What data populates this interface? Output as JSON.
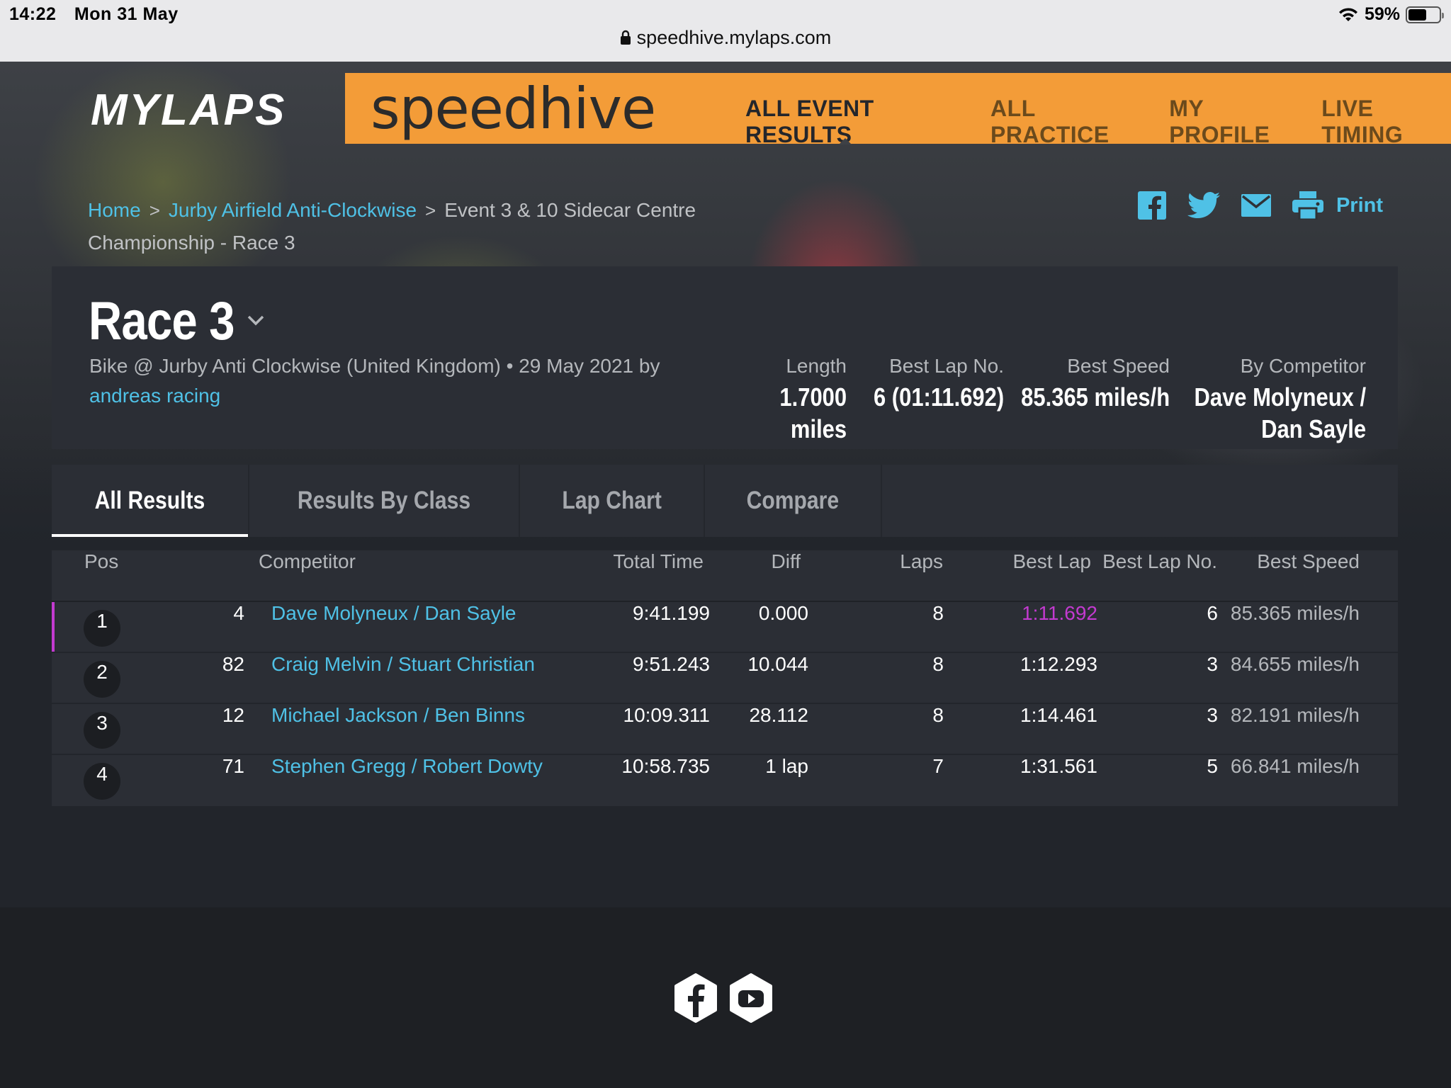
{
  "statusbar": {
    "time": "14:22",
    "date": "Mon 31 May",
    "battery": "59%",
    "battery_level": 0.59
  },
  "browser": {
    "url": "speedhive.mylaps.com"
  },
  "header": {
    "logo": "MYLAPS",
    "brand": "speedhive",
    "nav": [
      {
        "label": "ALL EVENT RESULTS",
        "active": true
      },
      {
        "label": "ALL PRACTICE"
      },
      {
        "label": "MY PROFILE"
      },
      {
        "label": "LIVE TIMING"
      }
    ]
  },
  "breadcrumb": {
    "home": "Home",
    "track": "Jurby Airfield Anti-Clockwise",
    "event": "Event 3 & 10 Sidecar Centre Championship - Race 3"
  },
  "share": {
    "print_label": "Print",
    "icons": [
      "facebook-icon",
      "twitter-icon",
      "mail-icon",
      "printer-icon"
    ]
  },
  "race": {
    "title": "Race 3",
    "subtitle": "Bike @ Jurby Anti Clockwise (United Kingdom) • 29 May 2021 by",
    "organizer": "andreas racing",
    "stats": {
      "length_label": "Length",
      "length_value": "1.7000",
      "length_unit": "miles",
      "best_lap_no_label": "Best Lap No.",
      "best_lap_no_value": "6 (01:11.692)",
      "best_speed_label": "Best Speed",
      "best_speed_value": "85.365 miles/h",
      "by_competitor_label": "By Competitor",
      "by_competitor_line1": "Dave Molyneux /",
      "by_competitor_line2": "Dan Sayle"
    }
  },
  "tabs": [
    {
      "label": "All Results",
      "active": true
    },
    {
      "label": "Results By Class"
    },
    {
      "label": "Lap Chart"
    },
    {
      "label": "Compare"
    }
  ],
  "table": {
    "headers": {
      "pos": "Pos",
      "competitor": "Competitor",
      "total_time": "Total Time",
      "diff": "Diff",
      "laps": "Laps",
      "best_lap": "Best Lap",
      "best_lap_no": "Best Lap No.",
      "best_speed": "Best Speed"
    },
    "rows": [
      {
        "pos": "1",
        "number": "4",
        "competitor": "Dave Molyneux / Dan Sayle",
        "total_time": "9:41.199",
        "diff": "0.000",
        "laps": "8",
        "best_lap": "1:11.692",
        "best_lap_no": "6",
        "best_speed": "85.365 miles/h"
      },
      {
        "pos": "2",
        "number": "82",
        "competitor": "Craig Melvin / Stuart Christian",
        "total_time": "9:51.243",
        "diff": "10.044",
        "laps": "8",
        "best_lap": "1:12.293",
        "best_lap_no": "3",
        "best_speed": "84.655 miles/h"
      },
      {
        "pos": "3",
        "number": "12",
        "competitor": "Michael Jackson / Ben Binns",
        "total_time": "10:09.311",
        "diff": "28.112",
        "laps": "8",
        "best_lap": "1:14.461",
        "best_lap_no": "3",
        "best_speed": "82.191 miles/h"
      },
      {
        "pos": "4",
        "number": "71",
        "competitor": "Stephen Gregg / Robert Dowty",
        "total_time": "10:58.735",
        "diff": "1 lap",
        "laps": "7",
        "best_lap": "1:31.561",
        "best_lap_no": "5",
        "best_speed": "66.841 miles/h"
      }
    ]
  },
  "footer": {
    "social_icons": [
      "facebook-hex-icon",
      "youtube-hex-icon"
    ]
  },
  "colors": {
    "accent": "#f39c38",
    "link": "#4fc1e6",
    "best_lap_highlight": "#c33ad0",
    "panel": "#2b2e35"
  }
}
